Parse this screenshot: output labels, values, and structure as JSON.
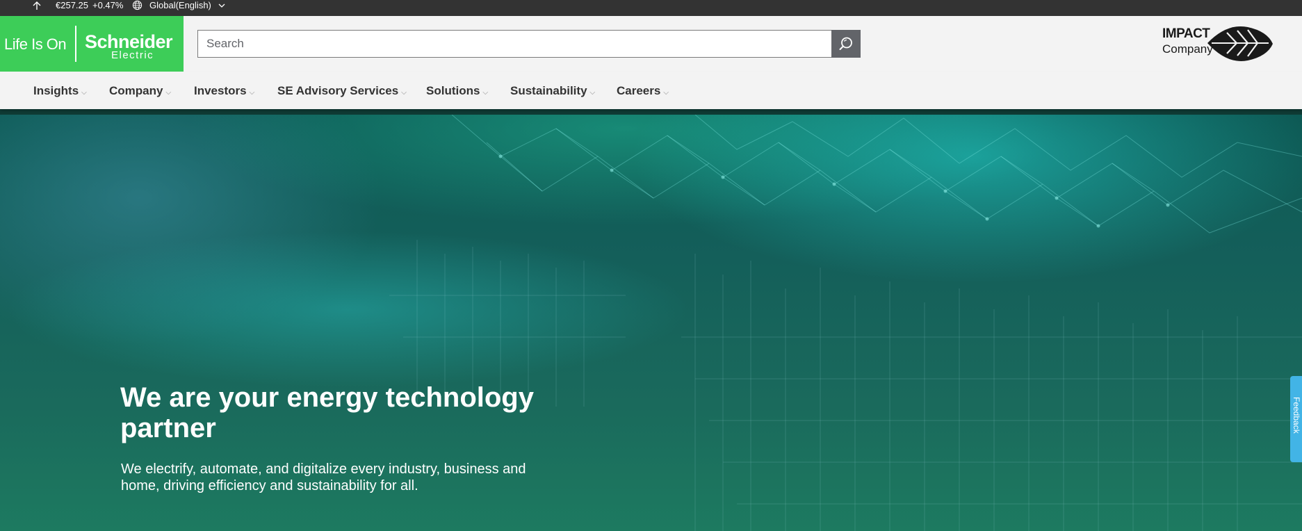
{
  "topbar": {
    "stock_icon": "arrow-up-icon",
    "stock_price": "€257.25",
    "stock_change": "+0.47%",
    "lang_icon": "globe-icon",
    "language": "Global(English)",
    "lang_chevron": "chevron-down-icon"
  },
  "header": {
    "logo": {
      "tagline": "Life Is On",
      "brand_line1": "Schneider",
      "brand_line2": "Electric"
    },
    "search": {
      "placeholder": "Search",
      "value": "",
      "button_icon": "search-icon"
    },
    "impact": {
      "line1": "IMPACT",
      "line2": "Company",
      "icon": "leaf-icon"
    }
  },
  "nav": {
    "items": [
      {
        "label": "Insights"
      },
      {
        "label": "Company"
      },
      {
        "label": "Investors"
      },
      {
        "label": "SE Advisory Services"
      },
      {
        "label": "Solutions"
      },
      {
        "label": "Sustainability"
      },
      {
        "label": "Careers"
      }
    ],
    "chevron": "⌵"
  },
  "hero": {
    "title": "We are your energy technology partner",
    "subtitle": "We electrify, automate, and digitalize every industry, business and home, driving efficiency and sustainability for all."
  },
  "feedback": {
    "label": "Feedback"
  },
  "colors": {
    "brand_green": "#3dcd58",
    "topbar_bg": "#333333",
    "header_bg": "#f3f3f3",
    "search_button_bg": "#626469",
    "feedback_bg": "#42b4e6"
  }
}
